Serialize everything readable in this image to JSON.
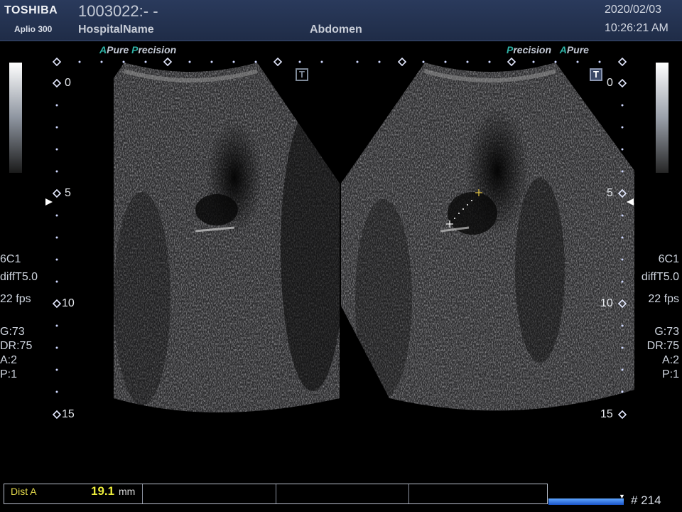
{
  "header": {
    "brand": "TOSHIBA",
    "model": "Aplio 300",
    "patient_id": "1003022:- -",
    "hospital": "HospitalName",
    "exam": "Abdomen",
    "date": "2020/02/03",
    "time": "10:26:21 AM"
  },
  "left_panel": {
    "feature_a_letter": "A",
    "feature_a_word": "Pure",
    "feature_p_letter": "P",
    "feature_p_rest": "recision",
    "depth_marks": [
      "0",
      "5",
      "10",
      "15"
    ],
    "probe": "6C1",
    "mode": "diffT5.0",
    "fps": "22 fps",
    "gain": "G:73",
    "dynamic_range": "DR:75",
    "a_setting": "A:2",
    "p_setting": "P:1"
  },
  "right_panel": {
    "feature_p_letter": "P",
    "feature_p_rest": "recision",
    "feature_a_letter": "A",
    "feature_a_word": "Pure",
    "depth_marks": [
      "0",
      "5",
      "10",
      "15"
    ],
    "probe": "6C1",
    "mode": "diffT5.0",
    "fps": "22 fps",
    "gain": "G:73",
    "dynamic_range": "DR:75",
    "a_setting": "A:2",
    "p_setting": "P:1"
  },
  "t_marker": "T",
  "measurement": {
    "label": "Dist A",
    "value": "19.1",
    "unit": "mm"
  },
  "cine": {
    "frame_label": "# 214"
  },
  "colors": {
    "header_bg": "#24324f",
    "accent_teal": "#2fb2a6",
    "measure_yellow": "#ecec3a",
    "caliper": "#e0c040"
  }
}
